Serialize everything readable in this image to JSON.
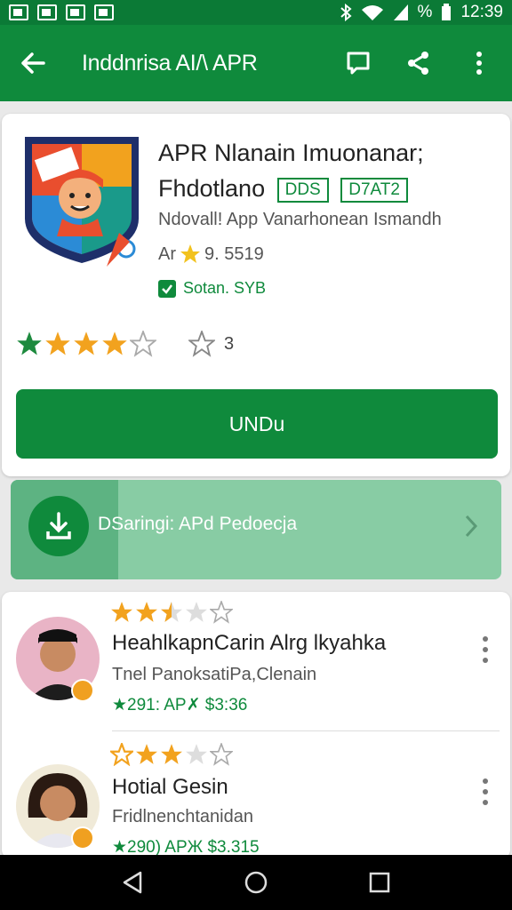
{
  "status_bar": {
    "battery_text": "%",
    "time": "12:39"
  },
  "app_bar": {
    "title": "Inddnrisa AI/\\ APR",
    "icons": [
      "back-arrow-icon",
      "chat-icon",
      "share-icon",
      "more-vert-icon"
    ]
  },
  "app": {
    "name": "APR Nlanain Imuonanar; Fhdotlano",
    "badge_1": "DDS",
    "badge_2": "D7AT2",
    "subtitle": "Ndovall! App Vanarhonean Ismandh",
    "version_prefix": "Ar",
    "version": "9. 5519",
    "verified": "Sotan. SYB",
    "rating_stars": 3.5,
    "rating_count": "3",
    "install_label": "UNDu"
  },
  "download": {
    "text": "DSaringi: APd Pedoecja",
    "progress": 0.22
  },
  "reviews": [
    {
      "stars": 2.5,
      "name": "HeahlkapnCarin Alrg lkyahka",
      "subtitle": "Tnel PanoksatiPa,Clenain",
      "meta": "★291: AP✗ $3:36"
    },
    {
      "stars": 2,
      "name": "Hotial Gesin",
      "subtitle": "Fridlnenchtanidan",
      "meta": "★290) APЖ $3.315"
    }
  ],
  "colors": {
    "primary": "#0f8a3c",
    "status_bar": "#0b7a36",
    "star_gold": "#f2a21e",
    "star_green": "#1d8a3e",
    "download_bg": "#88cca4"
  }
}
